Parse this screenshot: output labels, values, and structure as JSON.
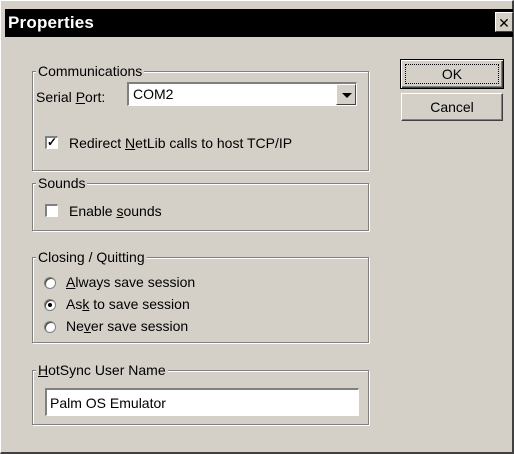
{
  "dialog": {
    "title": "Properties",
    "close_glyph": "✕"
  },
  "communications": {
    "legend": "Communications",
    "serial_port_label_pre": "Serial ",
    "serial_port_label_accel": "P",
    "serial_port_label_post": "ort:",
    "serial_port_value": "COM2",
    "redirect_checked": true,
    "redirect_check_glyph": "✓",
    "redirect_label_pre": "Redirect ",
    "redirect_label_accel": "N",
    "redirect_label_post": "etLib calls to host TCP/IP"
  },
  "sounds": {
    "legend": "Sounds",
    "enable_checked": false,
    "enable_label_pre": "Enable ",
    "enable_label_accel": "s",
    "enable_label_post": "ounds"
  },
  "closing": {
    "legend": "Closing / Quitting",
    "options": [
      {
        "pre": "",
        "accel": "A",
        "post": "lways save session",
        "selected": false
      },
      {
        "pre": "As",
        "accel": "k",
        "post": " to save session",
        "selected": true
      },
      {
        "pre": "Ne",
        "accel": "v",
        "post": "er save session",
        "selected": false
      }
    ]
  },
  "hotsync": {
    "legend_accel": "H",
    "legend_post": "otSync User Name",
    "user_name": "Palm OS Emulator"
  },
  "buttons": {
    "ok_label": "OK",
    "cancel_label": "Cancel"
  }
}
